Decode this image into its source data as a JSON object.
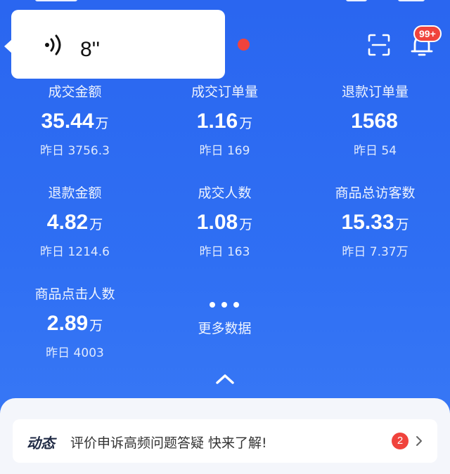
{
  "voice_message": {
    "duration": "8''"
  },
  "header": {
    "notification_badge": "99+"
  },
  "metrics": [
    {
      "label": "成交金额",
      "value": "35.44",
      "unit": "万",
      "yesterday": "昨日 3756.3"
    },
    {
      "label": "成交订单量",
      "value": "1.16",
      "unit": "万",
      "yesterday": "昨日 169"
    },
    {
      "label": "退款订单量",
      "value": "1568",
      "unit": "",
      "yesterday": "昨日 54"
    },
    {
      "label": "退款金额",
      "value": "4.82",
      "unit": "万",
      "yesterday": "昨日 1214.6"
    },
    {
      "label": "成交人数",
      "value": "1.08",
      "unit": "万",
      "yesterday": "昨日 163"
    },
    {
      "label": "商品总访客数",
      "value": "15.33",
      "unit": "万",
      "yesterday": "昨日 7.37万"
    },
    {
      "label": "商品点击人数",
      "value": "2.89",
      "unit": "万",
      "yesterday": "昨日 4003"
    }
  ],
  "more": {
    "label": "更多数据"
  },
  "news": {
    "tag": "动态",
    "text": "评价申诉高频问题答疑  快来了解!",
    "count": "2"
  },
  "colors": {
    "background": "#2f6ff3",
    "badge_red": "#f0433c",
    "card_background": "#f4f6fb"
  },
  "icons": [
    "voice-icon",
    "scan-icon",
    "bell-icon",
    "more-dots-icon",
    "chevron-up-icon",
    "chevron-right-icon"
  ]
}
